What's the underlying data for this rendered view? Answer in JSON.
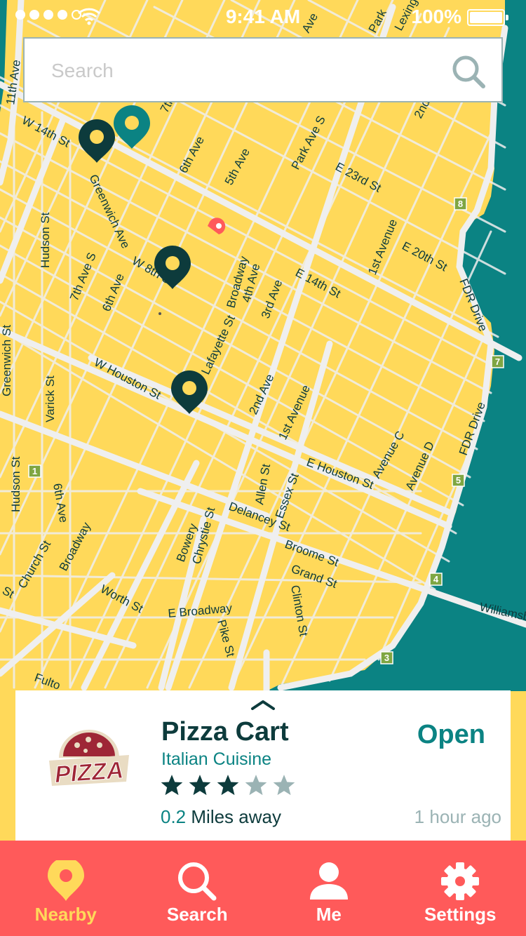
{
  "status_bar": {
    "time": "9:41 AM",
    "battery": "100%"
  },
  "search": {
    "placeholder": "Search"
  },
  "map": {
    "street_labels": [
      {
        "text": "W 14th St"
      },
      {
        "text": "Greenwich Ave"
      },
      {
        "text": "Hudson St"
      },
      {
        "text": "7th Ave S"
      },
      {
        "text": "6th Ave"
      },
      {
        "text": "W 8th St"
      },
      {
        "text": "6th Ave"
      },
      {
        "text": "5th Ave"
      },
      {
        "text": "Park Ave S"
      },
      {
        "text": "E 23rd St"
      },
      {
        "text": "1st Avenue"
      },
      {
        "text": "E 20th St"
      },
      {
        "text": "FDR Drive"
      },
      {
        "text": "Broadway"
      },
      {
        "text": "4th Ave"
      },
      {
        "text": "3rd Ave"
      },
      {
        "text": "E 14th St"
      },
      {
        "text": "W Houston St"
      },
      {
        "text": "Lafayette St"
      },
      {
        "text": "2nd Ave"
      },
      {
        "text": "1st Avenue"
      },
      {
        "text": "Greenwich St"
      },
      {
        "text": "Varick St"
      },
      {
        "text": "Hudson St"
      },
      {
        "text": "6th Ave"
      },
      {
        "text": "Broadway"
      },
      {
        "text": "Church St"
      },
      {
        "text": "E Houston St"
      },
      {
        "text": "Allen St"
      },
      {
        "text": "Essex St"
      },
      {
        "text": "Avenue C"
      },
      {
        "text": "Avenue D"
      },
      {
        "text": "FDR Drive"
      },
      {
        "text": "Delancey St"
      },
      {
        "text": "Bowery"
      },
      {
        "text": "Chrystie St"
      },
      {
        "text": "Broome St"
      },
      {
        "text": "Grand St"
      },
      {
        "text": "Clinton St"
      },
      {
        "text": "Worth St"
      },
      {
        "text": "E Broadway"
      },
      {
        "text": "Pike St"
      },
      {
        "text": "Williamsb"
      },
      {
        "text": "11th Ave"
      },
      {
        "text": "2nd"
      },
      {
        "text": "7th"
      },
      {
        "text": "Park"
      },
      {
        "text": "Lexingt"
      },
      {
        "text": "Fulto"
      },
      {
        "text": "St"
      },
      {
        "text": "Ave"
      }
    ],
    "exit_badges": [
      "8",
      "7",
      "5",
      "4",
      "3",
      "1"
    ],
    "colors": {
      "land": "#FFD95A",
      "water": "#0B8383",
      "road": "#EFEFEF",
      "pin": "#0D3B3C",
      "pin_teal": "#0B8383",
      "current": "#FF5A5A"
    }
  },
  "place_card": {
    "name": "Pizza Cart",
    "cuisine": "Italian Cuisine",
    "rating": 3,
    "max_rating": 5,
    "distance_value": "0.2",
    "distance_text": "Miles away",
    "status": "Open",
    "updated": "1 hour ago",
    "logo_text": "PIZZA"
  },
  "tabs": [
    {
      "label": "Nearby",
      "icon": "pin-icon",
      "active": true
    },
    {
      "label": "Search",
      "icon": "search-icon",
      "active": false
    },
    {
      "label": "Me",
      "icon": "user-icon",
      "active": false
    },
    {
      "label": "Settings",
      "icon": "gear-icon",
      "active": false
    }
  ]
}
